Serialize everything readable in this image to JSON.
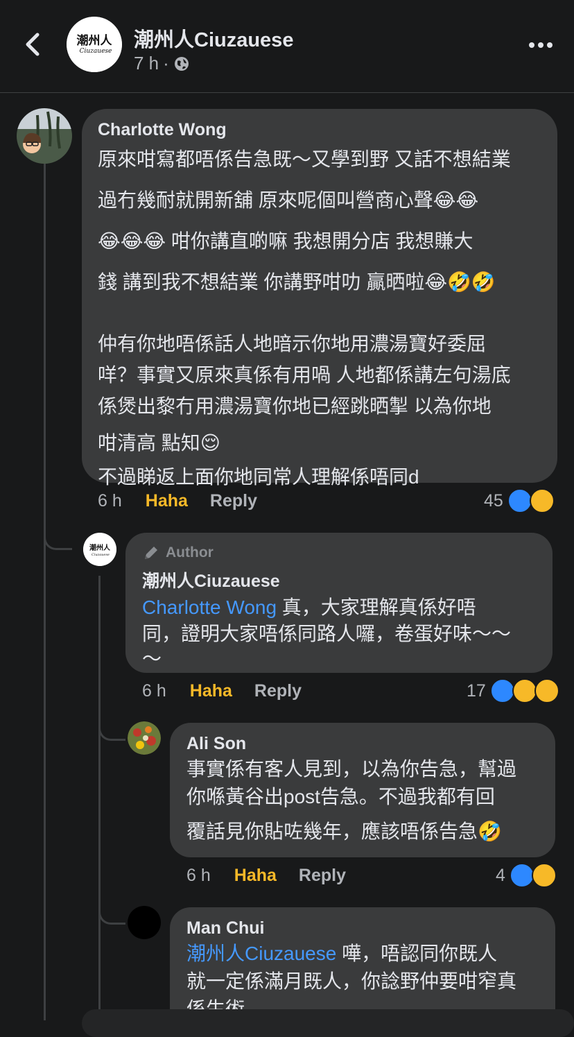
{
  "header": {
    "page_name": "潮州人Ciuzauese",
    "time": "7 h",
    "separator": "·",
    "logo_text": "潮州人",
    "logo_sub": "Ciuzauese"
  },
  "comments": [
    {
      "author": "Charlotte Wong",
      "lines": [
        "原來咁寫都唔係告急既～又學到野 又話不想結業",
        "過冇幾耐就開新舖 原來呢個叫營商心聲😂😂",
        "😂😂😂 咁你講直啲嘛 我想開分店 我想賺大",
        "錢 講到我不想結業 你講野咁叻 贏晒啦😂🤣🤣",
        "",
        "仲有你地唔係話人地暗示你地用濃湯寶好委屈",
        "咩？事實又原來真係有用喎 人地都係講左句湯底",
        "係煲出黎冇用濃湯寶你地已經跳晒掣 以為你地",
        "咁清高 點知😌",
        "不過睇返上面你地同常人理解係唔同d"
      ],
      "time": "6 h",
      "reaction_label": "Haha",
      "reply_label": "Reply",
      "reaction_count": "45"
    },
    {
      "badge": "Author",
      "author": "潮州人Ciuzauese",
      "mention": "Charlotte Wong",
      "lines_first": " 真，大家理解真係好唔",
      "lines": [
        "同，證明大家唔係同路人囉，卷蛋好味～～",
        "～"
      ],
      "time": "6 h",
      "reaction_label": "Haha",
      "reply_label": "Reply",
      "reaction_count": "17"
    },
    {
      "author": "Ali Son",
      "lines": [
        "事實係有客人見到，以為你告急，幫過",
        "你喺黃谷出post告急。不過我都有回",
        "覆話見你貼咗幾年，應該唔係告急🤣"
      ],
      "time": "6 h",
      "reaction_label": "Haha",
      "reply_label": "Reply",
      "reaction_count": "4"
    },
    {
      "author": "Man Chui",
      "mention": "潮州人Ciuzauese",
      "lines_first": " 嘩，唔認同你既人",
      "lines": [
        "就一定係滿月既人，你諗野仲要咁窄真",
        "係生術"
      ]
    }
  ],
  "colors": {
    "background": "#18191a",
    "bubble": "#3a3b3c",
    "mention": "#4599ff",
    "haha": "#f7b928",
    "like": "#2d88ff"
  },
  "icons": {
    "back": "chevron-left-icon",
    "more": "more-dots-icon",
    "privacy": "globe-icon",
    "author": "pen-icon"
  }
}
